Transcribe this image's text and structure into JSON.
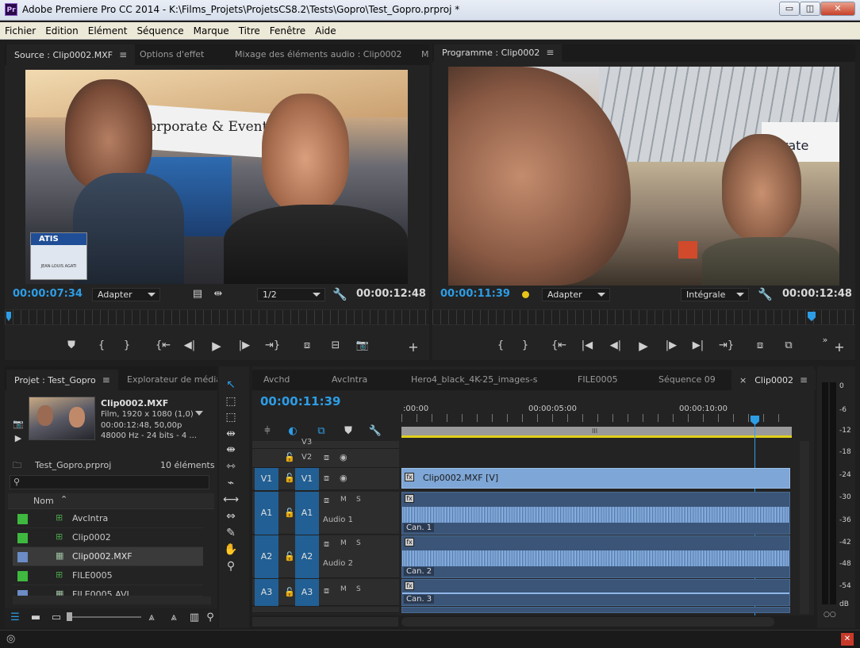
{
  "window": {
    "app_icon": "Pr",
    "title": "Adobe Premiere Pro CC 2014 - K:\\Films_Projets\\ProjetsCS8.2\\Tests\\Gopro\\Test_Gopro.prproj *",
    "minimize": "▭",
    "restore": "◫",
    "close": "✕"
  },
  "menu": [
    "Fichier",
    "Edition",
    "Elément",
    "Séquence",
    "Marque",
    "Titre",
    "Fenêtre",
    "Aide"
  ],
  "source": {
    "tabs": [
      "Source : Clip0002.MXF",
      "Options d'effet",
      "Mixage des éléments audio : Clip0002",
      "M"
    ],
    "timecode": "00:00:07:34",
    "fit": "Adapter",
    "resolution": "1/2",
    "duration": "00:00:12:48",
    "frame_text": "Corporate & Event",
    "badge_text": "ATIS",
    "badge_name": "JEAN-LOUIS AGATI"
  },
  "program": {
    "tab": "Programme : Clip0002",
    "timecode": "00:00:11:39",
    "fit": "Adapter",
    "resolution": "Intégrale",
    "duration": "00:00:12:48",
    "frame_text": "orate"
  },
  "project": {
    "tabs": [
      "Projet : Test_Gopro",
      "Explorateur de médias"
    ],
    "clip_name": "Clip0002.MXF",
    "clip_info": [
      "Film, 1920 x 1080 (1,0)",
      "00:00:12:48, 50,00p",
      "48000 Hz - 24 bits - 4 ..."
    ],
    "project_file": "Test_Gopro.prproj",
    "count": "10 éléments",
    "column": "Nom",
    "items": [
      {
        "name": "AvcIntra",
        "color": "#3fb83f"
      },
      {
        "name": "Clip0002",
        "color": "#3fb83f"
      },
      {
        "name": "Clip0002.MXF",
        "color": "#6b8cc4"
      },
      {
        "name": "FILE0005",
        "color": "#3fb83f"
      },
      {
        "name": "FILE0005.AVI",
        "color": "#6b8cc4"
      }
    ]
  },
  "timeline": {
    "tabs": [
      "Avchd",
      "AvcIntra",
      "Hero4_black_4K-25_images-s",
      "FILE0005",
      "Séquence 09",
      "Clip0002"
    ],
    "close_glyph": "×",
    "timecode": "00:00:11:39",
    "ruler": [
      ":00:00",
      "00:00:05:00",
      "00:00:10:00"
    ],
    "video_tracks": [
      {
        "label": "V3"
      },
      {
        "label": "V2"
      },
      {
        "label": "V1",
        "src": "V1",
        "clip": "Clip0002.MXF [V]"
      }
    ],
    "audio_tracks": [
      {
        "label": "A1",
        "src": "A1",
        "name": "Audio 1",
        "chan": "Can. 1"
      },
      {
        "label": "A2",
        "src": "A2",
        "name": "Audio 2",
        "chan": "Can. 2"
      },
      {
        "label": "A3",
        "src": "A3",
        "name": "",
        "chan": "Can. 3"
      }
    ],
    "m": "M",
    "s": "S"
  },
  "meter": [
    "0",
    "-6",
    "-12",
    "-18",
    "-24",
    "-30",
    "-36",
    "-42",
    "-48",
    "-54",
    "dB"
  ]
}
